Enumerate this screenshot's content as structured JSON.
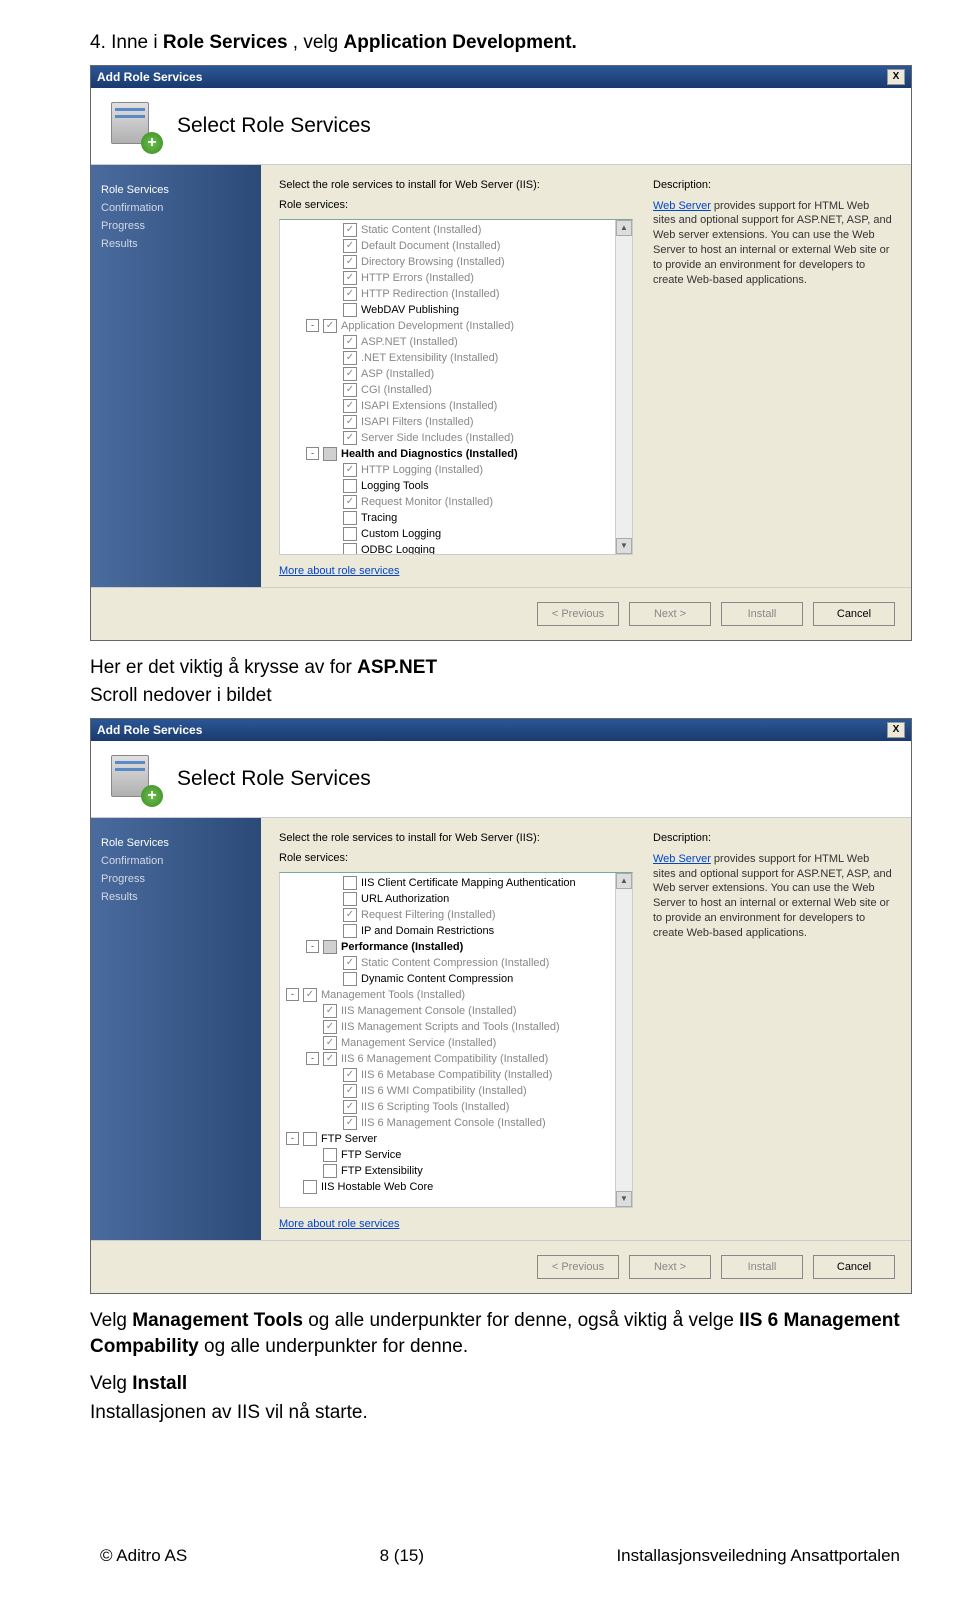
{
  "doc": {
    "line1_pre": "4. Inne i ",
    "line1_b1": "Role Services",
    "line1_mid": " , velg ",
    "line1_b2": "Application Development.",
    "line2_pre": "Her er det viktig å krysse av for ",
    "line2_b": "ASP.NET",
    "line3": "Scroll nedover i bildet",
    "line4_pre": "Velg ",
    "line4_b1": "Management Tools",
    "line4_mid": " og alle underpunkter for denne, også viktig å velge ",
    "line4_b2": "IIS 6 Management Compability",
    "line4_post": " og alle underpunkter for denne.",
    "line5_pre": "Velg ",
    "line5_b": "Install",
    "line6": "Installasjonen av IIS vil nå starte."
  },
  "dialog": {
    "title": "Add Role Services",
    "header": "Select Role Services",
    "close": "X",
    "sidebar": [
      "Role Services",
      "Confirmation",
      "Progress",
      "Results"
    ],
    "prompt": "Select the role services to install for Web Server (IIS):",
    "roleservices_label": "Role services:",
    "description_label": "Description:",
    "more": "More about role services",
    "desc_link": "Web Server",
    "desc_text": " provides support for HTML Web sites and optional support for ASP.NET, ASP, and Web server extensions. You can use the Web Server to host an internal or external Web site or to provide an environment for developers to create Web-based applications.",
    "buttons": {
      "prev": "< Previous",
      "next": "Next >",
      "install": "Install",
      "cancel": "Cancel"
    }
  },
  "tree1": [
    {
      "indent": 2,
      "chk": "checked",
      "txt": "Static Content  (Installed)",
      "dis": true
    },
    {
      "indent": 2,
      "chk": "checked",
      "txt": "Default Document  (Installed)",
      "dis": true
    },
    {
      "indent": 2,
      "chk": "checked",
      "txt": "Directory Browsing  (Installed)",
      "dis": true
    },
    {
      "indent": 2,
      "chk": "checked",
      "txt": "HTTP Errors  (Installed)",
      "dis": true
    },
    {
      "indent": 2,
      "chk": "checked",
      "txt": "HTTP Redirection  (Installed)",
      "dis": true
    },
    {
      "indent": 2,
      "chk": "",
      "txt": "WebDAV Publishing"
    },
    {
      "indent": 1,
      "exp": "-",
      "chk": "checked",
      "txt": "Application Development  (Installed)",
      "dis": true
    },
    {
      "indent": 2,
      "chk": "checked",
      "txt": "ASP.NET  (Installed)",
      "dis": true
    },
    {
      "indent": 2,
      "chk": "checked",
      "txt": ".NET Extensibility  (Installed)",
      "dis": true
    },
    {
      "indent": 2,
      "chk": "checked",
      "txt": "ASP  (Installed)",
      "dis": true
    },
    {
      "indent": 2,
      "chk": "checked",
      "txt": "CGI  (Installed)",
      "dis": true
    },
    {
      "indent": 2,
      "chk": "checked",
      "txt": "ISAPI Extensions  (Installed)",
      "dis": true
    },
    {
      "indent": 2,
      "chk": "checked",
      "txt": "ISAPI Filters  (Installed)",
      "dis": true
    },
    {
      "indent": 2,
      "chk": "checked",
      "txt": "Server Side Includes  (Installed)",
      "dis": true
    },
    {
      "indent": 1,
      "exp": "-",
      "chk": "tri",
      "txt": "Health and Diagnostics  (Installed)",
      "bold": true
    },
    {
      "indent": 2,
      "chk": "checked",
      "txt": "HTTP Logging  (Installed)",
      "dis": true
    },
    {
      "indent": 2,
      "chk": "",
      "txt": "Logging Tools"
    },
    {
      "indent": 2,
      "chk": "checked",
      "txt": "Request Monitor  (Installed)",
      "dis": true
    },
    {
      "indent": 2,
      "chk": "",
      "txt": "Tracing"
    },
    {
      "indent": 2,
      "chk": "",
      "txt": "Custom Logging"
    },
    {
      "indent": 2,
      "chk": "",
      "txt": "ODBC Logging"
    }
  ],
  "tree2": [
    {
      "indent": 2,
      "chk": "",
      "txt": "IIS Client Certificate Mapping Authentication"
    },
    {
      "indent": 2,
      "chk": "",
      "txt": "URL Authorization"
    },
    {
      "indent": 2,
      "chk": "checked",
      "txt": "Request Filtering  (Installed)",
      "dis": true
    },
    {
      "indent": 2,
      "chk": "",
      "txt": "IP and Domain Restrictions"
    },
    {
      "indent": 1,
      "exp": "-",
      "chk": "tri",
      "txt": "Performance  (Installed)",
      "bold": true
    },
    {
      "indent": 2,
      "chk": "checked",
      "txt": "Static Content Compression  (Installed)",
      "dis": true
    },
    {
      "indent": 2,
      "chk": "",
      "txt": "Dynamic Content Compression"
    },
    {
      "indent": 0,
      "exp": "-",
      "chk": "checked",
      "txt": "Management Tools  (Installed)",
      "dis": true
    },
    {
      "indent": 1,
      "chk": "checked",
      "txt": "IIS Management Console  (Installed)",
      "dis": true
    },
    {
      "indent": 1,
      "chk": "checked",
      "txt": "IIS Management Scripts and Tools  (Installed)",
      "dis": true
    },
    {
      "indent": 1,
      "chk": "checked",
      "txt": "Management Service  (Installed)",
      "dis": true
    },
    {
      "indent": 1,
      "exp": "-",
      "chk": "checked",
      "txt": "IIS 6 Management Compatibility  (Installed)",
      "dis": true
    },
    {
      "indent": 2,
      "chk": "checked",
      "txt": "IIS 6 Metabase Compatibility  (Installed)",
      "dis": true
    },
    {
      "indent": 2,
      "chk": "checked",
      "txt": "IIS 6 WMI Compatibility  (Installed)",
      "dis": true
    },
    {
      "indent": 2,
      "chk": "checked",
      "txt": "IIS 6 Scripting Tools  (Installed)",
      "dis": true
    },
    {
      "indent": 2,
      "chk": "checked",
      "txt": "IIS 6 Management Console  (Installed)",
      "dis": true
    },
    {
      "indent": 0,
      "exp": "-",
      "chk": "",
      "txt": "FTP Server"
    },
    {
      "indent": 1,
      "chk": "",
      "txt": "FTP Service"
    },
    {
      "indent": 1,
      "chk": "",
      "txt": "FTP Extensibility"
    },
    {
      "indent": 0,
      "chk": "",
      "txt": "IIS Hostable Web Core"
    }
  ],
  "footer": {
    "left": "© Aditro AS",
    "center": "8 (15)",
    "right": "Installasjonsveiledning Ansattportalen"
  }
}
